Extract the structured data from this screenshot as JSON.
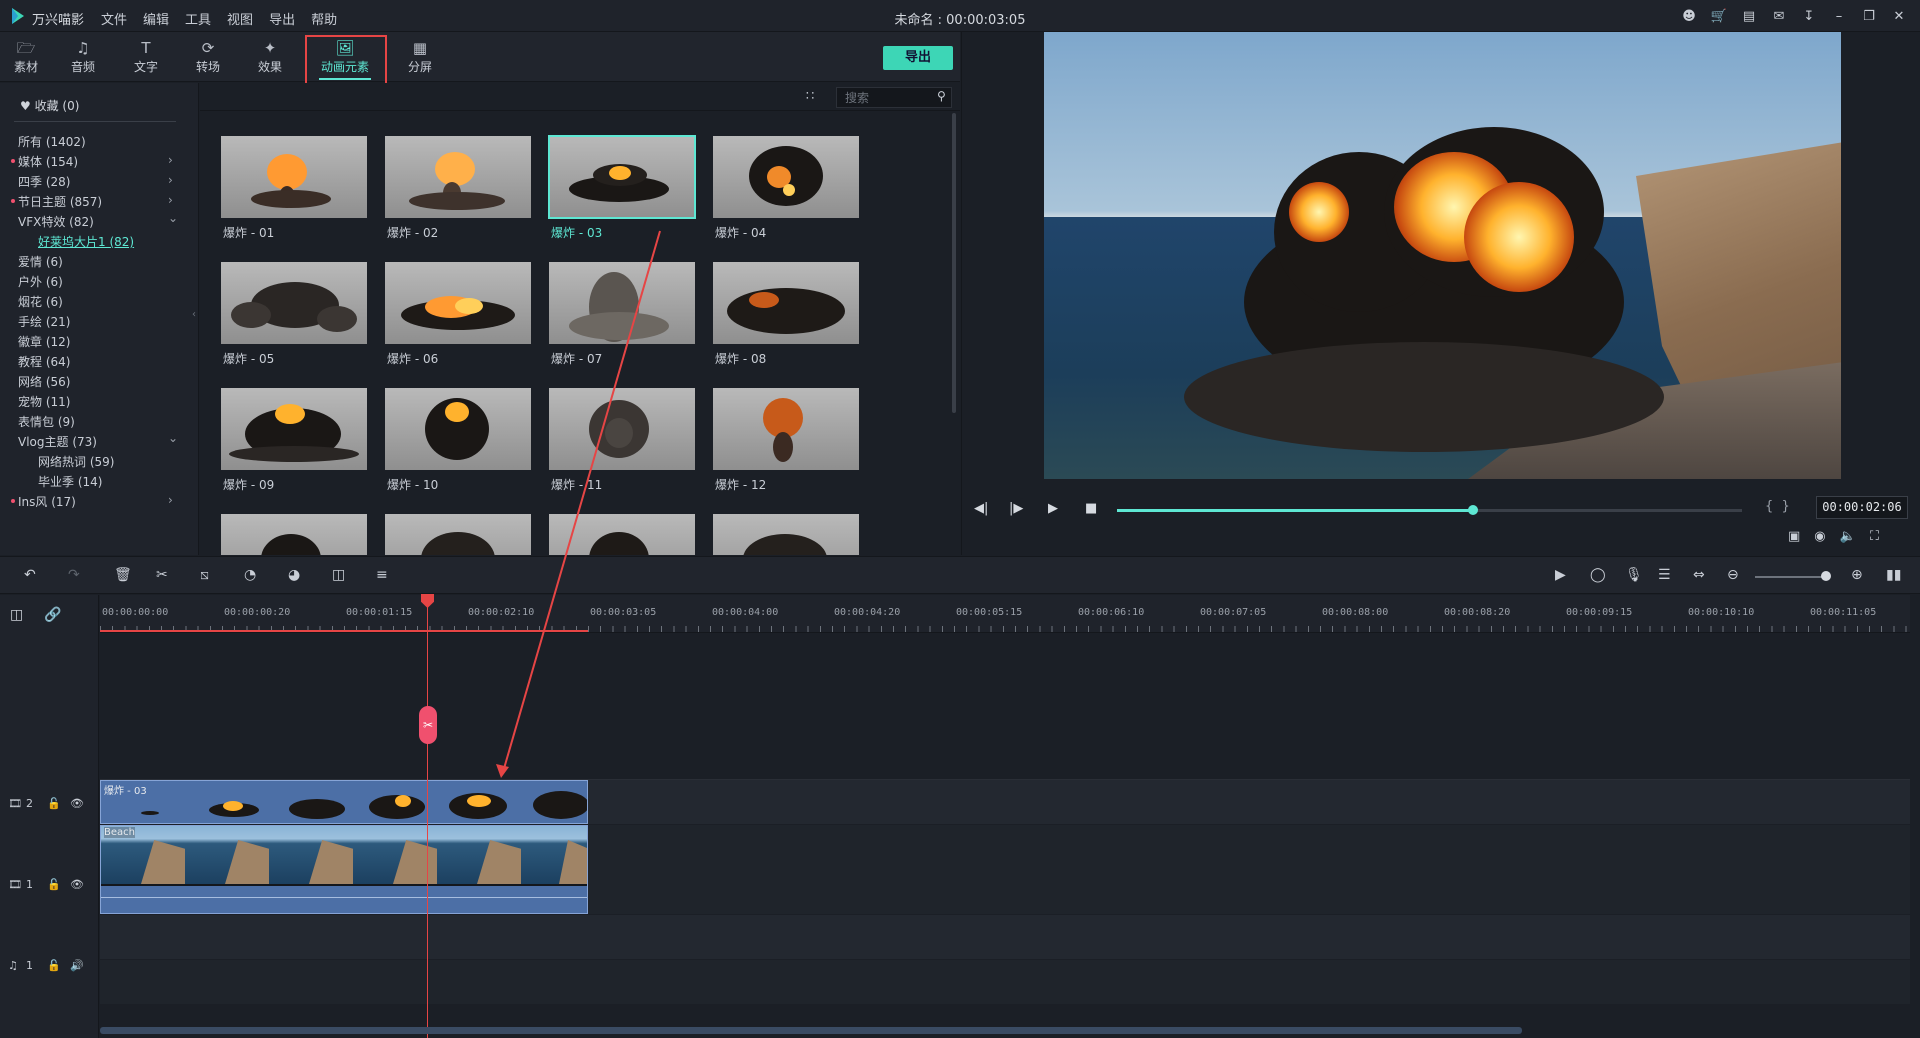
{
  "titlebar": {
    "app_name": "万兴喵影",
    "menu": [
      "文件",
      "编辑",
      "工具",
      "视图",
      "导出",
      "帮助"
    ],
    "doc_title": "未命名 : 00:00:03:05",
    "icons": [
      "user-icon",
      "cart-icon",
      "save-icon",
      "mail-icon",
      "download-icon",
      "minimize-icon",
      "restore-icon",
      "close-icon"
    ]
  },
  "toolbar": {
    "tabs": [
      {
        "label": "素材",
        "icon": "folder-icon"
      },
      {
        "label": "音频",
        "icon": "music-note-icon"
      },
      {
        "label": "文字",
        "icon": "text-icon"
      },
      {
        "label": "转场",
        "icon": "transition-icon"
      },
      {
        "label": "效果",
        "icon": "effects-icon"
      },
      {
        "label": "动画元素",
        "icon": "image-icon"
      },
      {
        "label": "分屏",
        "icon": "split-screen-icon"
      }
    ],
    "active_tab": "动画元素",
    "export_label": "导出"
  },
  "sidebar": {
    "favorites": "收藏 (0)",
    "items": [
      {
        "label": "所有 (1402)"
      },
      {
        "label": "媒体 (154)",
        "dot": true
      },
      {
        "label": "四季 (28)"
      },
      {
        "label": "节日主题 (857)",
        "dot": true
      },
      {
        "label": "VFX特效 (82)"
      },
      {
        "label": "好莱坞大片1 (82)"
      },
      {
        "label": "爱情 (6)"
      },
      {
        "label": "户外 (6)"
      },
      {
        "label": "烟花 (6)"
      },
      {
        "label": "手绘 (21)"
      },
      {
        "label": "徽章 (12)"
      },
      {
        "label": "教程 (64)"
      },
      {
        "label": "网络 (56)"
      },
      {
        "label": "宠物 (11)"
      },
      {
        "label": "表情包 (9)"
      },
      {
        "label": "Vlog主题 (73)"
      },
      {
        "label": "网络热词 (59)"
      },
      {
        "label": "毕业季 (14)"
      },
      {
        "label": "Ins风 (17)",
        "dot": true
      }
    ],
    "selected": "好莱坞大片1 (82)"
  },
  "library": {
    "search_placeholder": "搜索",
    "tiles": [
      {
        "label": "爆炸 - 01"
      },
      {
        "label": "爆炸 - 02"
      },
      {
        "label": "爆炸 - 03"
      },
      {
        "label": "爆炸 - 04"
      },
      {
        "label": "爆炸 - 05"
      },
      {
        "label": "爆炸 - 06"
      },
      {
        "label": "爆炸 - 07"
      },
      {
        "label": "爆炸 - 08"
      },
      {
        "label": "爆炸 - 09"
      },
      {
        "label": "爆炸 - 10"
      },
      {
        "label": "爆炸 - 11"
      },
      {
        "label": "爆炸 - 12"
      },
      {
        "label": ""
      },
      {
        "label": ""
      },
      {
        "label": ""
      },
      {
        "label": ""
      }
    ],
    "selected_tile": "爆炸 - 03"
  },
  "preview": {
    "timecode": "00:00:02:06",
    "progress_fraction": 0.57,
    "controls": [
      "step-back-icon",
      "step-forward-icon",
      "play-icon",
      "stop-icon"
    ],
    "extra_icons": [
      "display-settings-icon",
      "snapshot-icon",
      "volume-icon",
      "fullscreen-icon"
    ]
  },
  "timeline": {
    "ruler_labels": [
      "00:00:00:00",
      "00:00:00:20",
      "00:00:01:15",
      "00:00:02:10",
      "00:00:03:05",
      "00:00:04:00",
      "00:00:04:20",
      "00:00:05:15",
      "00:00:06:10",
      "00:00:07:05",
      "00:00:08:00",
      "00:00:08:20",
      "00:00:09:15",
      "00:00:10:10",
      "00:00:11:05"
    ],
    "tracks": [
      {
        "id": "2",
        "type": "video"
      },
      {
        "id": "1",
        "type": "video"
      },
      {
        "id": "1",
        "type": "audio"
      }
    ],
    "clips": [
      {
        "title": "爆炸 - 03",
        "track": "2"
      },
      {
        "title": "Beach",
        "track": "1"
      }
    ]
  },
  "colors": {
    "accent": "#5ee7d3",
    "highlight": "#e64545",
    "clip": "#4c6fa6"
  }
}
